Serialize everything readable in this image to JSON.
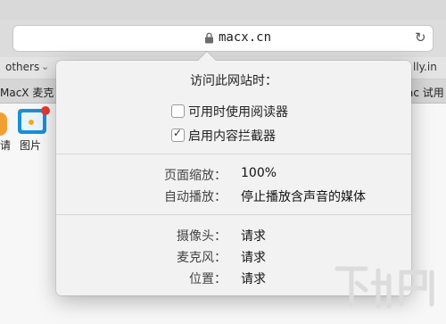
{
  "address_bar": {
    "url": "macx.cn",
    "reload_glyph": "↻"
  },
  "bookmarks": {
    "left_label": "others",
    "arrow": "⌄",
    "right_label": "lly.in"
  },
  "tabs": {
    "left_label": "MacX 麦克",
    "right_label": "ac 试用"
  },
  "page": {
    "shortcut_left_label": "请",
    "shortcut_images_label": "图片"
  },
  "popover": {
    "title": "访问此网站时：",
    "reader_option": {
      "label": "可用时使用阅读器",
      "checked": false
    },
    "blocker_option": {
      "label": "启用内容拦截器",
      "checked": true
    },
    "zoom": {
      "key": "页面缩放：",
      "value": "100%"
    },
    "autoplay": {
      "key": "自动播放：",
      "value": "停止播放含声音的媒体"
    },
    "camera": {
      "key": "摄像头：",
      "value": "请求"
    },
    "microphone": {
      "key": "麦克风：",
      "value": "请求"
    },
    "location": {
      "key": "位置：",
      "value": "请求"
    }
  },
  "colors": {
    "accent_orange": "#f0a030",
    "image_icon_blue": "#1a8fd6"
  }
}
